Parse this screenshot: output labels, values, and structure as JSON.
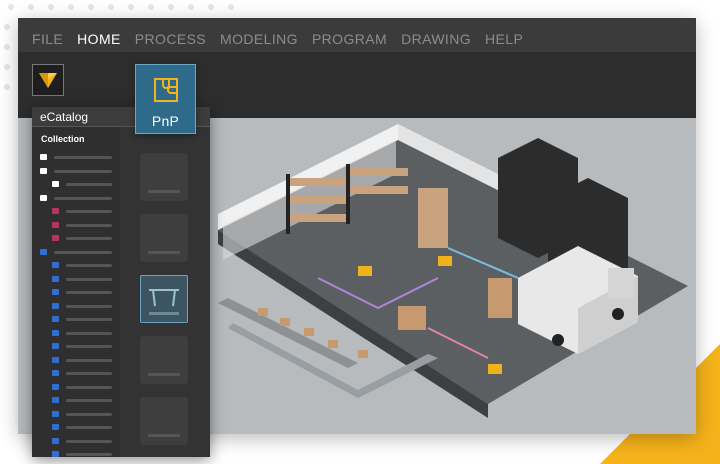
{
  "menu": [
    {
      "label": "FILE",
      "active": false
    },
    {
      "label": "HOME",
      "active": true
    },
    {
      "label": "PROCESS",
      "active": false
    },
    {
      "label": "MODELING",
      "active": false
    },
    {
      "label": "PROGRAM",
      "active": false
    },
    {
      "label": "DRAWING",
      "active": false
    },
    {
      "label": "HELP",
      "active": false
    }
  ],
  "ribbon": {
    "logo_icon": "visual-components-logo-icon",
    "pnp_label": "PnP",
    "pnp_icon": "puzzle-piece-icon"
  },
  "catalog": {
    "title": "eCatalog",
    "collection_label": "Collection",
    "tree_items": [
      {
        "color": "#ffffff",
        "indent": 0
      },
      {
        "color": "#ffffff",
        "indent": 0
      },
      {
        "color": "#ffffff",
        "indent": 1
      },
      {
        "color": "#ffffff",
        "indent": 0
      },
      {
        "color": "#b8345a",
        "indent": 1
      },
      {
        "color": "#b8345a",
        "indent": 1
      },
      {
        "color": "#b8345a",
        "indent": 1
      },
      {
        "color": "#2f6fd0",
        "indent": 0
      },
      {
        "color": "#2f6fd0",
        "indent": 1
      },
      {
        "color": "#2f6fd0",
        "indent": 1
      },
      {
        "color": "#2f6fd0",
        "indent": 1
      },
      {
        "color": "#2f6fd0",
        "indent": 1
      },
      {
        "color": "#2f6fd0",
        "indent": 1
      },
      {
        "color": "#2f6fd0",
        "indent": 1
      },
      {
        "color": "#2f6fd0",
        "indent": 1
      },
      {
        "color": "#2f6fd0",
        "indent": 1
      },
      {
        "color": "#2f6fd0",
        "indent": 1
      },
      {
        "color": "#2f6fd0",
        "indent": 1
      },
      {
        "color": "#2f6fd0",
        "indent": 1
      },
      {
        "color": "#2f6fd0",
        "indent": 1
      },
      {
        "color": "#2f6fd0",
        "indent": 1
      },
      {
        "color": "#2f6fd0",
        "indent": 1
      },
      {
        "color": "#2f6fd0",
        "indent": 1
      }
    ],
    "thumbnails": [
      {
        "selected": false
      },
      {
        "selected": false
      },
      {
        "selected": true,
        "icon": "conveyor-icon"
      },
      {
        "selected": false
      },
      {
        "selected": false
      }
    ]
  },
  "scene": {
    "description_icon": "warehouse-3d-layout-icon"
  },
  "colors": {
    "accent": "#f5b21a",
    "selection_blue": "#2e6a8a",
    "menu_bg": "#3b3b3b",
    "panel_bg": "#2b2b2b"
  }
}
